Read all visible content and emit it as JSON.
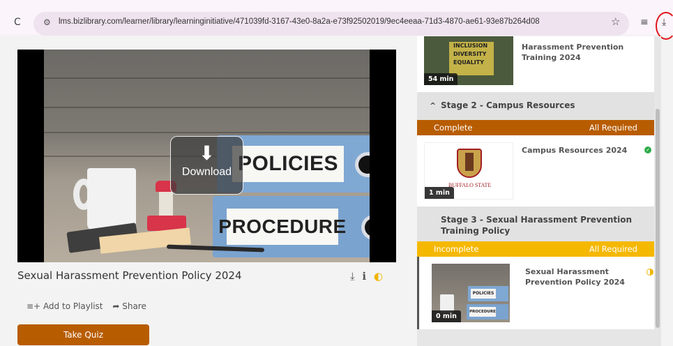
{
  "browser": {
    "url": "lms.bizlibrary.com/learner/library/learninginitiative/471039fd-3167-43e0-8a2a-e73f92502019/9ec4eeaa-71d3-4870-ae61-93e87b264d08",
    "reload_icon": "C",
    "tune_icon": "⚙",
    "bookmark_icon": "☆",
    "playlist_icon": "≡",
    "download_icon": "⤓"
  },
  "player": {
    "binder_top_label": "POLICIES",
    "binder_bottom_label": "PROCEDURE",
    "download_overlay": {
      "icon": "⬇",
      "label": "Download"
    }
  },
  "course": {
    "title": "Sexual Harassment Prevention Policy 2024",
    "icons": {
      "download": "⤓",
      "info": "ℹ",
      "status": "◐"
    },
    "add_to_playlist_icon": "≡+",
    "add_to_playlist": "Add to Playlist",
    "share_icon": "➦",
    "share": "Share",
    "take_quiz": "Take Quiz"
  },
  "sidebar": {
    "top_card": {
      "title_line1": "Harassment Prevention",
      "title_line2": "Training 2024",
      "duration": "54 min",
      "thumb_words": [
        "INCLUSION",
        "DIVERSITY",
        "EQUALITY"
      ]
    },
    "stage2": {
      "chevron": "^",
      "title": "Stage 2 - Campus Resources",
      "status": "Complete",
      "requirement": "All Required",
      "status_color": "#b85c00",
      "card": {
        "title": "Campus Resources 2024",
        "duration": "1 min",
        "thumb_text": "BUFFALO STATE",
        "complete_icon": "✓"
      }
    },
    "stage3": {
      "title_line1": "Stage 3 - Sexual Harassment Prevention",
      "title_line2": "Training Policy",
      "status": "Incomplete",
      "requirement": "All Required",
      "status_color": "#f5b800",
      "card": {
        "title_line1": "Sexual Harassment",
        "title_line2": "Prevention Policy 2024",
        "duration": "0 min",
        "thumb_label1": "POLICIES",
        "thumb_label2": "PROCEDURE"
      }
    }
  }
}
